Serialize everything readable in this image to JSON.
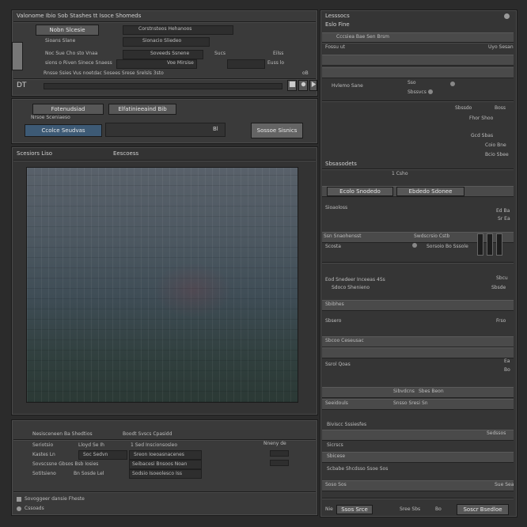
{
  "top_panel": {
    "title": "Valonome  Ibio Sob Stashes tt Isoce Shomeds",
    "row1_left": "Nobn Slcesie",
    "row1_mid": "Corstnsteos  Hehanoos",
    "row2_left": "Sioans Slane",
    "row2_mid": "Sionacio  Sliedeo",
    "row3_a": "Noc Sue  Cho sto Vnaa",
    "row3_b": "Soveeds Ssnene",
    "row3_c": "Sucs",
    "row3_d": "Eilss",
    "row4_a": "sions o Riven Sinece Snaess",
    "row4_b": "Voe Mirsise",
    "row4_c": "Euss lo",
    "row5_a": "Rnsse  Ssies  Vus noetdac  Sosees  Srese  Srelsls  3sto",
    "row5_b": "oB",
    "id_label": "DT",
    "icon_back": "back-icon",
    "icon_fwd": "forward-icon",
    "icon_stop": "stop-icon"
  },
  "toolbar2": {
    "left_label": "Fotenudsiad",
    "right_label": "Elfatinieeaind  Bib",
    "small_label": "Nrsoe  Sceniaeso",
    "small_btn": "Ccolce  Seudvas",
    "field_value": "Bl",
    "action_btn": "Sossoe Sisnics"
  },
  "viewport": {
    "title_left": "Scesiors  Liso",
    "title_right": "Eescoess"
  },
  "bottom_panel": {
    "col1_title": "Nesisceneen  Ba  Shedtios",
    "col2_title": "Boodt  Svscs  Cpasidd",
    "rows": [
      {
        "a": "Seriotsio",
        "b": "Lloyd  Se Ih",
        "c": "1 Sed  Inscionsosleo",
        "d": "Nneny de"
      },
      {
        "a": "Kastes  Ln",
        "b": "Soc Sedvn",
        "c": "Sreon  Ioeoasnacenes",
        "d": ""
      },
      {
        "a": "Sovscssne  Gbsos  Bsb  Iosies",
        "b": "",
        "c": "Seibacesi  Bnsoos  Noan",
        "d": ""
      },
      {
        "a": "Sotitsieno",
        "b": "Bn  Sosde  Lel",
        "c": "Sodsio  Isoeolesco  Iss",
        "d": ""
      }
    ],
    "footer1": "Sovoggeer  dansie  Fheste",
    "footer2": "Cssoads"
  },
  "right_panel": {
    "title": "Lesssocs",
    "subtitle": "Eslo  Fine",
    "row_a": "Cccsiea  Bae  Sen Brsm",
    "row_b_left": "Fossu ut",
    "row_b_right": "Uyo Sesan",
    "row_c_left": "Hvlemo  Sane",
    "row_c_mid1": "Sso",
    "row_c_mid2": "Sbssvcs",
    "row_d1_left": "Sbssdo",
    "row_d1_right": "Boss",
    "row_d2": "Fhor  Shoo",
    "row_d3": "Gcd  Sbas",
    "row_d4": "Coio Bne",
    "row_d5": "Bcio Sbee",
    "section_title": "Sbsasodets",
    "section_field": "1 Csho",
    "combo1": "Ecolo  Snodedo",
    "combo2": "Ebdedo  Sdonee",
    "line1_left": "Sioaoloss",
    "line1_right": "Ed Ba",
    "line1_sub": "Sr  Ea",
    "group2_left": "Ssn  Snaohensst",
    "group2_right": "Swdscrsio  Cstb",
    "group2_row": "Scosta",
    "group2_meta": "Sorsoio  Bo  Sssole",
    "group3_a": "Eod Snedeer  Inceeas  4Ss",
    "group3_b": "Sdoco  Shenieno",
    "group3_right": "Sbcu",
    "group3_right2": "Sbsde",
    "strip1": "Sbibhes",
    "line2_left": "Sbsero",
    "line2_right": "Frso",
    "strip2": "Sbcoo  Ceseusac",
    "line3_left": "Ssrol  Qoas",
    "line3_right": "Ea",
    "line3_right2": "Bo",
    "strip3": "Sibvdcns",
    "strip3_right": "Sbes  Beon",
    "group4": "Seeidouls",
    "group4_mid": "Snsso  Sresi  Sn",
    "sub1": "Biviscc  Sssiesfes",
    "sub1_right": "Sedssos",
    "sub2": "Sicrscs",
    "sub3": "Sbicese",
    "sub4": "Scbabe  Shcdsso  Ssoe  Sos",
    "line4_left": "Soso  Sos",
    "line4_right": "Sue Sea",
    "footer_a": "Nie",
    "footer_b": "Ssos  Srce",
    "footer_c": "Sree  Sbs",
    "footer_d": "Bo",
    "footer_btn": "Soscr Bsedloe"
  }
}
